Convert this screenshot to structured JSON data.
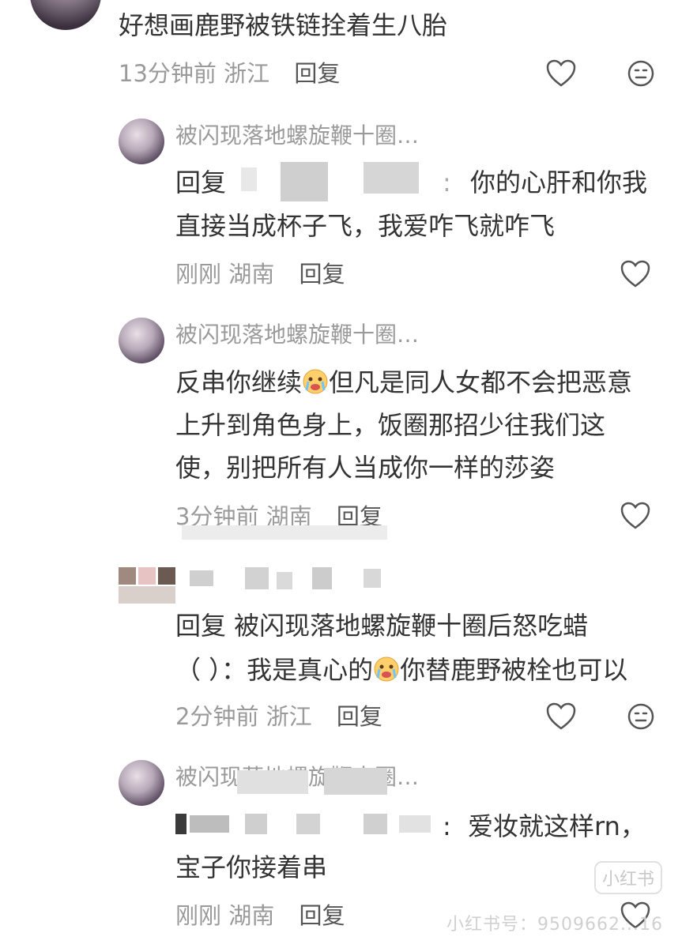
{
  "top_comment": {
    "text": "好想画鹿野被铁链拴着生八胎",
    "time_loc": "13分钟前 浙江",
    "reply": "回复"
  },
  "replies": [
    {
      "name": "被闪现落地螺旋鞭十圈…",
      "line1_prefix": "回复",
      "line1_text": "你的心肝和你我",
      "line2": "直接当成杯子飞，我爱咋飞就咋飞",
      "time_loc": "刚刚 湖南",
      "reply": "回复"
    },
    {
      "name": "被闪现落地螺旋鞭十圈…",
      "line1": "反串你继续",
      "line1_after": "但凡是同人女都不会把恶意",
      "line2": "上升到角色身上，饭圈那招少往我们这",
      "line3": "使，别把所有人当成你一样的莎姿",
      "time_loc": "3分钟前 湖南",
      "reply": "回复"
    },
    {
      "line1": "回复 被闪现落地螺旋鞭十圈后怒吃蜡",
      "line2_a": "（ ）：我是真心的",
      "line2_b": "你替鹿野被栓也可以",
      "time_loc": "2分钟前 浙江",
      "reply": "回复"
    },
    {
      "name": "被闪现落地螺旋鞭十圈…",
      "line1_text": "爱妆就这样rn，",
      "line2": "宝子你接着串",
      "time_loc": "刚刚 湖南",
      "reply": "回复"
    }
  ],
  "watermark": {
    "logo": "小红书",
    "id_line": "小红书号：9509662...16"
  },
  "colors": {
    "text": "#333333",
    "meta": "#9a9a9a",
    "icon": "#555555"
  }
}
